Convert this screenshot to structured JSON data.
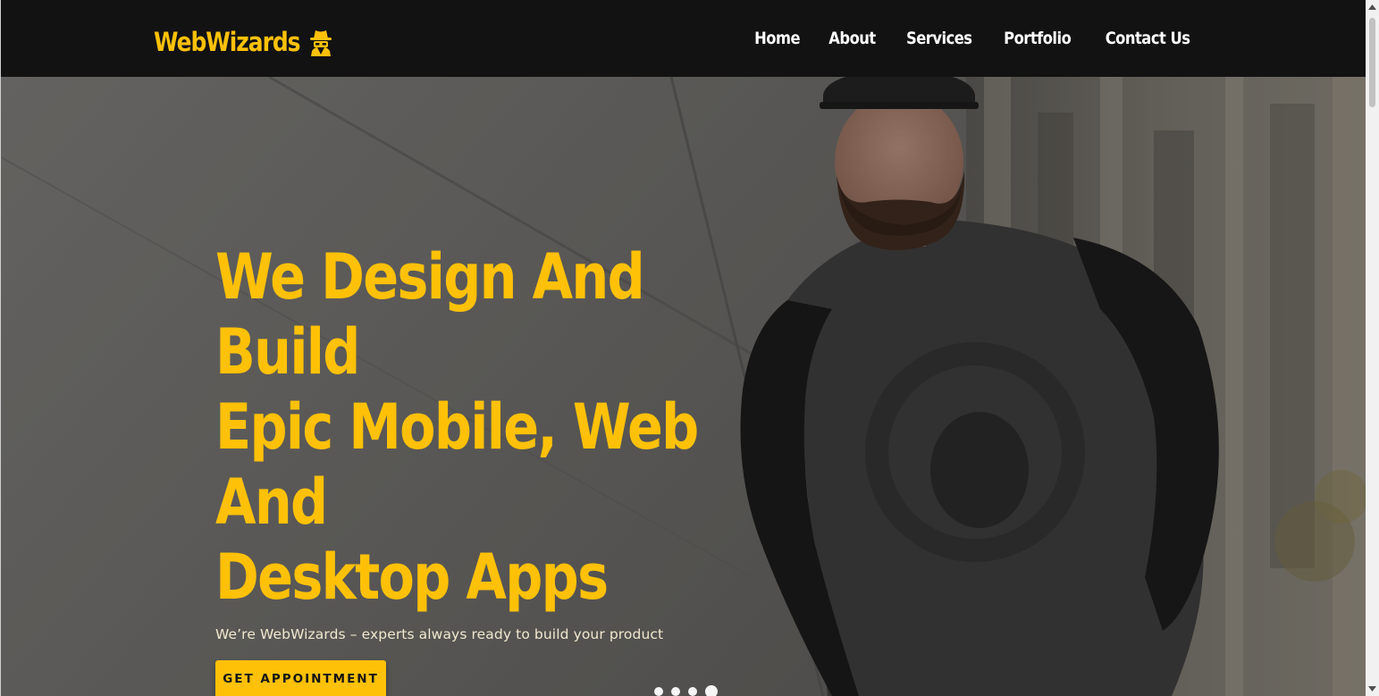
{
  "navbar": {
    "logo_text": "WebWizards",
    "logo_icon": "user-secret-icon",
    "links": [
      "Home",
      "About",
      "Services",
      "Portfolio",
      "Contact Us"
    ]
  },
  "hero": {
    "title": "We Design And Build\nEpic Mobile, Web And\nDesktop Apps",
    "subtitle": "We’re WebWizards – experts always ready to build your product",
    "button_label": "GET APPOINTMENT",
    "slide_count": 4,
    "active_slide": 4
  },
  "colors": {
    "accent": "#ffc107",
    "navbar_bg": "#121212",
    "nav_text": "#ffffff"
  }
}
